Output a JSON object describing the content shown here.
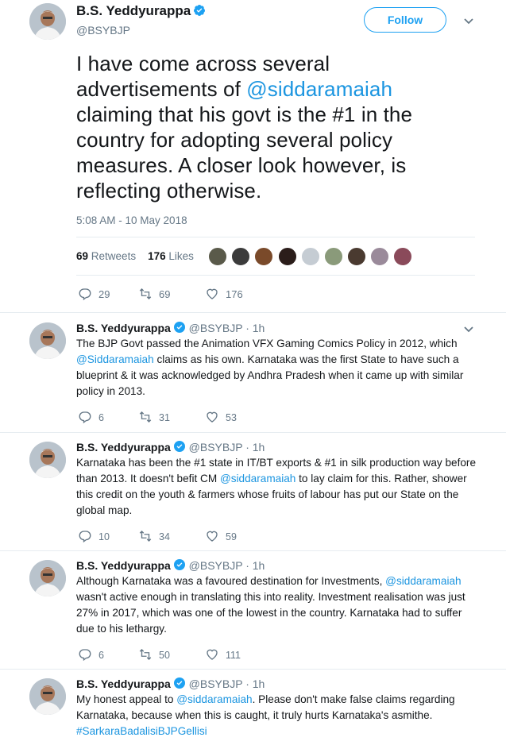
{
  "main": {
    "name": "B.S. Yeddyurappa",
    "handle": "@BSYBJP",
    "follow_label": "Follow",
    "text_before": "I have come across several advertisements of ",
    "mention": "@siddaramaiah",
    "text_after": " claiming that his govt is the #1 in the country for adopting several policy measures. A closer look however, is reflecting otherwise.",
    "timestamp": "5:08 AM - 10 May 2018",
    "retweets_count": "69",
    "retweets_label": "Retweets",
    "likes_count": "176",
    "likes_label": "Likes",
    "replies": "29",
    "retweets": "69",
    "likes": "176"
  },
  "replies": [
    {
      "name": "B.S. Yeddyurappa",
      "handle_time": "@BSYBJP · 1h",
      "text_a": "The BJP Govt passed the Animation VFX Gaming Comics Policy in 2012, which ",
      "mention": "@Siddaramaiah",
      "text_b": " claims as his own. Karnataka was the first State to have such a blueprint & it was acknowledged by Andhra Pradesh when it came up with similar policy in 2013.",
      "replies": "6",
      "retweets": "31",
      "likes": "53"
    },
    {
      "name": "B.S. Yeddyurappa",
      "handle_time": "@BSYBJP · 1h",
      "text_a": "Karnataka has been the #1 state in IT/BT exports & #1 in silk production way before than 2013. It doesn't befit CM ",
      "mention": "@siddaramaiah",
      "text_b": " to lay claim for this. Rather, shower this credit on the youth & farmers whose fruits of labour has put our State on the global map.",
      "replies": "10",
      "retweets": "34",
      "likes": "59"
    },
    {
      "name": "B.S. Yeddyurappa",
      "handle_time": "@BSYBJP · 1h",
      "text_a": "Although Karnataka was a favoured destination for Investments, ",
      "mention": "@siddaramaiah",
      "text_b": " wasn't active enough in translating this into reality. Investment realisation was just 27% in 2017, which was one of the lowest in the country. Karnataka had to suffer due to his lethargy.",
      "replies": "6",
      "retweets": "50",
      "likes": "111"
    },
    {
      "name": "B.S. Yeddyurappa",
      "handle_time": "@BSYBJP · 1h",
      "text_a": "My honest appeal to ",
      "mention": "@siddaramaiah",
      "text_b": ". Please don't make false claims regarding Karnataka, because when this is caught, it truly hurts Karnataka's asmithe.",
      "hashtag": "#SarkaraBadalisiBJPGellisi"
    }
  ],
  "icons": {
    "verified": "verified-badge-icon",
    "reply": "reply-icon",
    "retweet": "retweet-icon",
    "like": "heart-icon",
    "more": "chevron-down-icon"
  },
  "colors": {
    "link": "#1b95e0",
    "muted": "#657786",
    "follow": "#1da1f2"
  }
}
